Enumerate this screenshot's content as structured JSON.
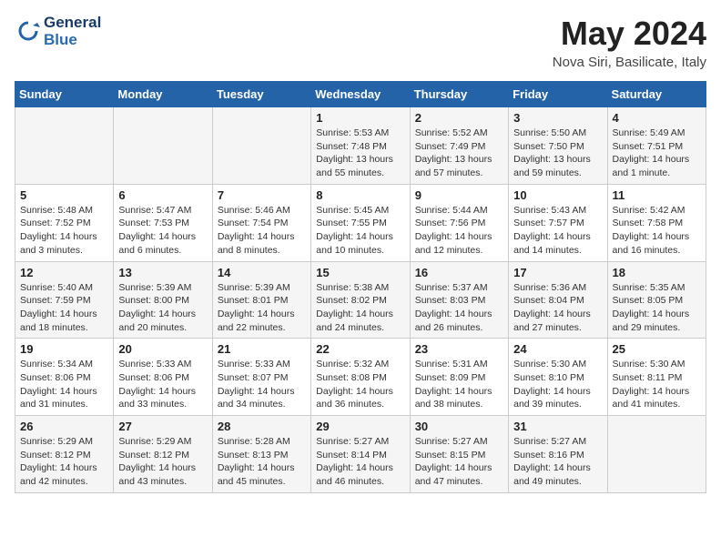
{
  "header": {
    "logo_general": "General",
    "logo_blue": "Blue",
    "month_title": "May 2024",
    "subtitle": "Nova Siri, Basilicate, Italy"
  },
  "weekdays": [
    "Sunday",
    "Monday",
    "Tuesday",
    "Wednesday",
    "Thursday",
    "Friday",
    "Saturday"
  ],
  "weeks": [
    [
      {
        "day": "",
        "info": ""
      },
      {
        "day": "",
        "info": ""
      },
      {
        "day": "",
        "info": ""
      },
      {
        "day": "1",
        "info": "Sunrise: 5:53 AM\nSunset: 7:48 PM\nDaylight: 13 hours\nand 55 minutes."
      },
      {
        "day": "2",
        "info": "Sunrise: 5:52 AM\nSunset: 7:49 PM\nDaylight: 13 hours\nand 57 minutes."
      },
      {
        "day": "3",
        "info": "Sunrise: 5:50 AM\nSunset: 7:50 PM\nDaylight: 13 hours\nand 59 minutes."
      },
      {
        "day": "4",
        "info": "Sunrise: 5:49 AM\nSunset: 7:51 PM\nDaylight: 14 hours\nand 1 minute."
      }
    ],
    [
      {
        "day": "5",
        "info": "Sunrise: 5:48 AM\nSunset: 7:52 PM\nDaylight: 14 hours\nand 3 minutes."
      },
      {
        "day": "6",
        "info": "Sunrise: 5:47 AM\nSunset: 7:53 PM\nDaylight: 14 hours\nand 6 minutes."
      },
      {
        "day": "7",
        "info": "Sunrise: 5:46 AM\nSunset: 7:54 PM\nDaylight: 14 hours\nand 8 minutes."
      },
      {
        "day": "8",
        "info": "Sunrise: 5:45 AM\nSunset: 7:55 PM\nDaylight: 14 hours\nand 10 minutes."
      },
      {
        "day": "9",
        "info": "Sunrise: 5:44 AM\nSunset: 7:56 PM\nDaylight: 14 hours\nand 12 minutes."
      },
      {
        "day": "10",
        "info": "Sunrise: 5:43 AM\nSunset: 7:57 PM\nDaylight: 14 hours\nand 14 minutes."
      },
      {
        "day": "11",
        "info": "Sunrise: 5:42 AM\nSunset: 7:58 PM\nDaylight: 14 hours\nand 16 minutes."
      }
    ],
    [
      {
        "day": "12",
        "info": "Sunrise: 5:40 AM\nSunset: 7:59 PM\nDaylight: 14 hours\nand 18 minutes."
      },
      {
        "day": "13",
        "info": "Sunrise: 5:39 AM\nSunset: 8:00 PM\nDaylight: 14 hours\nand 20 minutes."
      },
      {
        "day": "14",
        "info": "Sunrise: 5:39 AM\nSunset: 8:01 PM\nDaylight: 14 hours\nand 22 minutes."
      },
      {
        "day": "15",
        "info": "Sunrise: 5:38 AM\nSunset: 8:02 PM\nDaylight: 14 hours\nand 24 minutes."
      },
      {
        "day": "16",
        "info": "Sunrise: 5:37 AM\nSunset: 8:03 PM\nDaylight: 14 hours\nand 26 minutes."
      },
      {
        "day": "17",
        "info": "Sunrise: 5:36 AM\nSunset: 8:04 PM\nDaylight: 14 hours\nand 27 minutes."
      },
      {
        "day": "18",
        "info": "Sunrise: 5:35 AM\nSunset: 8:05 PM\nDaylight: 14 hours\nand 29 minutes."
      }
    ],
    [
      {
        "day": "19",
        "info": "Sunrise: 5:34 AM\nSunset: 8:06 PM\nDaylight: 14 hours\nand 31 minutes."
      },
      {
        "day": "20",
        "info": "Sunrise: 5:33 AM\nSunset: 8:06 PM\nDaylight: 14 hours\nand 33 minutes."
      },
      {
        "day": "21",
        "info": "Sunrise: 5:33 AM\nSunset: 8:07 PM\nDaylight: 14 hours\nand 34 minutes."
      },
      {
        "day": "22",
        "info": "Sunrise: 5:32 AM\nSunset: 8:08 PM\nDaylight: 14 hours\nand 36 minutes."
      },
      {
        "day": "23",
        "info": "Sunrise: 5:31 AM\nSunset: 8:09 PM\nDaylight: 14 hours\nand 38 minutes."
      },
      {
        "day": "24",
        "info": "Sunrise: 5:30 AM\nSunset: 8:10 PM\nDaylight: 14 hours\nand 39 minutes."
      },
      {
        "day": "25",
        "info": "Sunrise: 5:30 AM\nSunset: 8:11 PM\nDaylight: 14 hours\nand 41 minutes."
      }
    ],
    [
      {
        "day": "26",
        "info": "Sunrise: 5:29 AM\nSunset: 8:12 PM\nDaylight: 14 hours\nand 42 minutes."
      },
      {
        "day": "27",
        "info": "Sunrise: 5:29 AM\nSunset: 8:12 PM\nDaylight: 14 hours\nand 43 minutes."
      },
      {
        "day": "28",
        "info": "Sunrise: 5:28 AM\nSunset: 8:13 PM\nDaylight: 14 hours\nand 45 minutes."
      },
      {
        "day": "29",
        "info": "Sunrise: 5:27 AM\nSunset: 8:14 PM\nDaylight: 14 hours\nand 46 minutes."
      },
      {
        "day": "30",
        "info": "Sunrise: 5:27 AM\nSunset: 8:15 PM\nDaylight: 14 hours\nand 47 minutes."
      },
      {
        "day": "31",
        "info": "Sunrise: 5:27 AM\nSunset: 8:16 PM\nDaylight: 14 hours\nand 49 minutes."
      },
      {
        "day": "",
        "info": ""
      }
    ]
  ]
}
